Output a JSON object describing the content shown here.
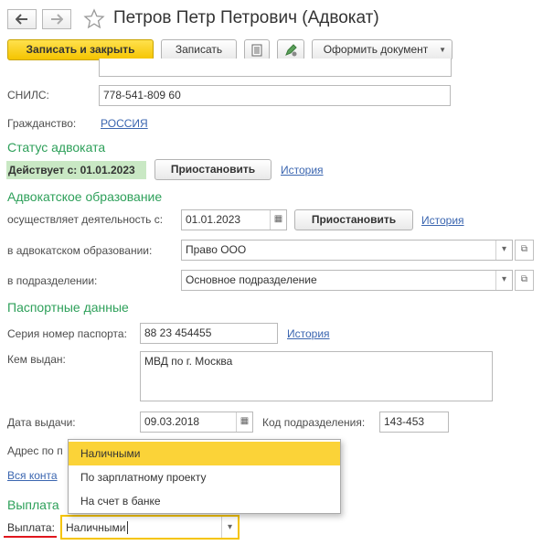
{
  "window": {
    "title": "Петров Петр Петрович (Адвокат)"
  },
  "nav": {
    "back_icon": "arrow-left-icon",
    "forward_icon": "arrow-right-icon",
    "favorite_icon": "star-icon"
  },
  "toolbar": {
    "save_close": "Записать и закрыть",
    "save": "Записать",
    "print_icon": "document-icon",
    "attach_icon": "edit-pen-icon",
    "make_document": "Оформить документ"
  },
  "fields": {
    "snils_label": "СНИЛС:",
    "snils_value": "778-541-809 60",
    "citizenship_label": "Гражданство:",
    "citizenship_value": "РОССИЯ"
  },
  "status": {
    "title": "Статус адвоката",
    "active": "Действует с: 01.01.2023",
    "suspend": "Приостановить",
    "history": "История"
  },
  "education": {
    "title": "Адвокатское образование",
    "activity_label": "осуществляет деятельность с:",
    "activity_date": "01.01.2023",
    "suspend": "Приостановить",
    "history": "История",
    "org_label": "в адвокатском образовании:",
    "org_value": "Право ООО",
    "dept_label": "в подразделении:",
    "dept_value": "Основное подразделение"
  },
  "passport": {
    "title": "Паспортные данные",
    "series_label": "Серия номер паспорта:",
    "series_value": "88 23 454455",
    "history": "История",
    "issued_by_label": "Кем выдан:",
    "issued_by_value": "МВД по г. Москва",
    "issue_date_label": "Дата выдачи:",
    "issue_date_value": "09.03.2018",
    "dept_code_label": "Код подразделения:",
    "dept_code_value": "143-453"
  },
  "address": {
    "label_partial": "Адрес по п",
    "contacts_link_partial": "Вся конта"
  },
  "payment": {
    "section_partial": "Выплата",
    "label": "Выплата:",
    "value": "Наличными",
    "options": [
      "Наличными",
      "По зарплатному проекту",
      "На счет в банке"
    ],
    "selected_index": 0
  },
  "colors": {
    "accent_green": "#2ea05a",
    "link_blue": "#3b66b0",
    "primary_yellow": "#f5c400",
    "highlight": "#fbd338",
    "status_bg": "#c9e8c4",
    "underline_red": "#e0161d"
  }
}
